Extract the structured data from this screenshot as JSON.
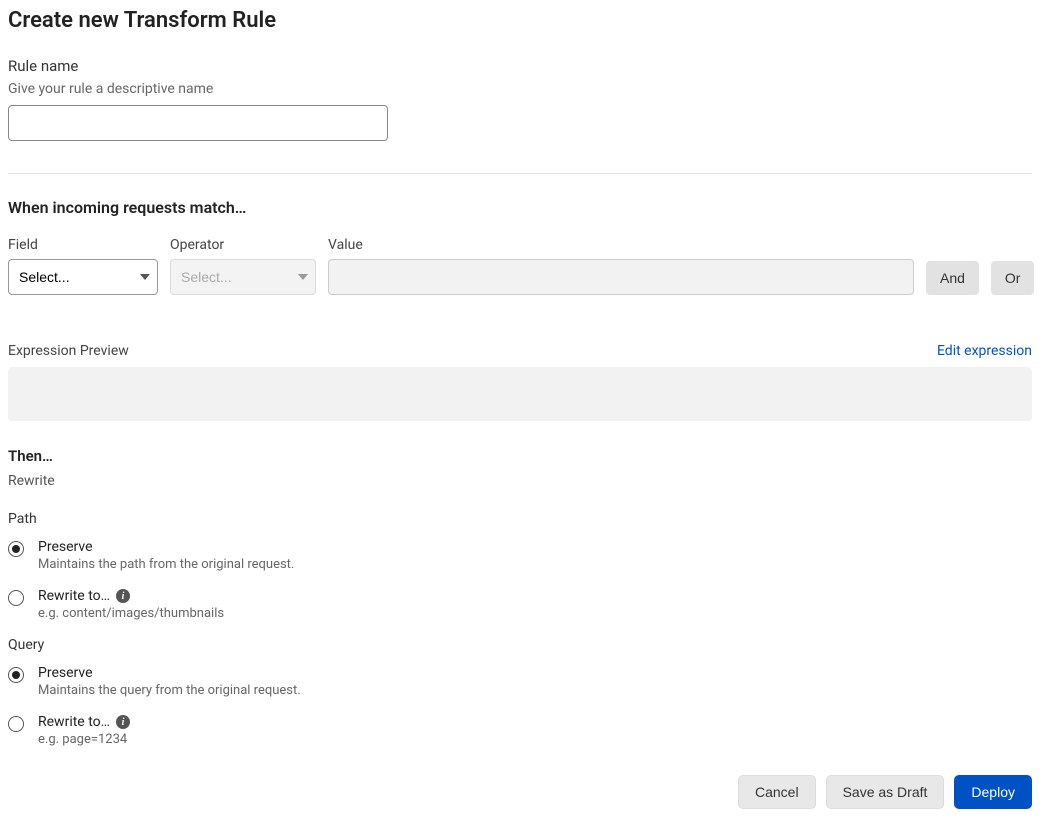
{
  "page_title": "Create new Transform Rule",
  "rule_name": {
    "label": "Rule name",
    "hint": "Give your rule a descriptive name",
    "value": ""
  },
  "match": {
    "heading": "When incoming requests match…",
    "field_label": "Field",
    "field_placeholder": "Select...",
    "operator_label": "Operator",
    "operator_placeholder": "Select...",
    "value_label": "Value",
    "and_label": "And",
    "or_label": "Or"
  },
  "preview": {
    "label": "Expression Preview",
    "edit_link": "Edit expression"
  },
  "then": {
    "heading": "Then…",
    "sub": "Rewrite",
    "path": {
      "label": "Path",
      "preserve_label": "Preserve",
      "preserve_desc": "Maintains the path from the original request.",
      "rewrite_label": "Rewrite to…",
      "rewrite_desc": "e.g. content/images/thumbnails"
    },
    "query": {
      "label": "Query",
      "preserve_label": "Preserve",
      "preserve_desc": "Maintains the query from the original request.",
      "rewrite_label": "Rewrite to…",
      "rewrite_desc": "e.g. page=1234"
    }
  },
  "footer": {
    "cancel": "Cancel",
    "save_draft": "Save as Draft",
    "deploy": "Deploy"
  }
}
